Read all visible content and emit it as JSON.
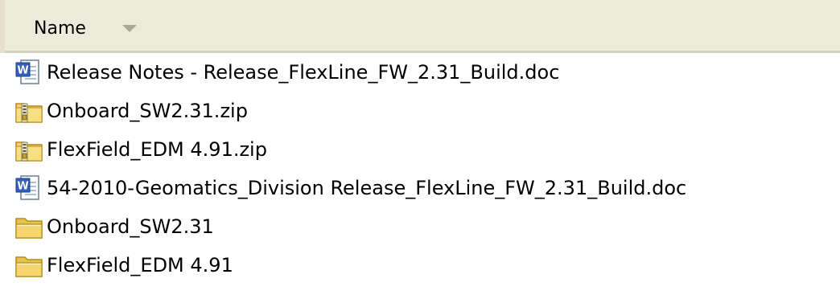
{
  "header": {
    "name_label": "Name",
    "sort_icon": "sort-descending-icon"
  },
  "files": [
    {
      "name": "Release Notes - Release_FlexLine_FW_2.31_Build.doc",
      "icon": "word-document-icon"
    },
    {
      "name": "Onboard_SW2.31.zip",
      "icon": "zip-folder-icon"
    },
    {
      "name": "FlexField_EDM 4.91.zip",
      "icon": "zip-folder-icon"
    },
    {
      "name": "54-2010-Geomatics_Division Release_FlexLine_FW_2.31_Build.doc",
      "icon": "word-document-icon"
    },
    {
      "name": "Onboard_SW2.31",
      "icon": "folder-icon"
    },
    {
      "name": "FlexField_EDM 4.91",
      "icon": "folder-icon"
    }
  ],
  "colors": {
    "header_background": "#ebeadb",
    "folder_yellow": "#f2d46a",
    "word_blue": "#2f5fbf"
  }
}
